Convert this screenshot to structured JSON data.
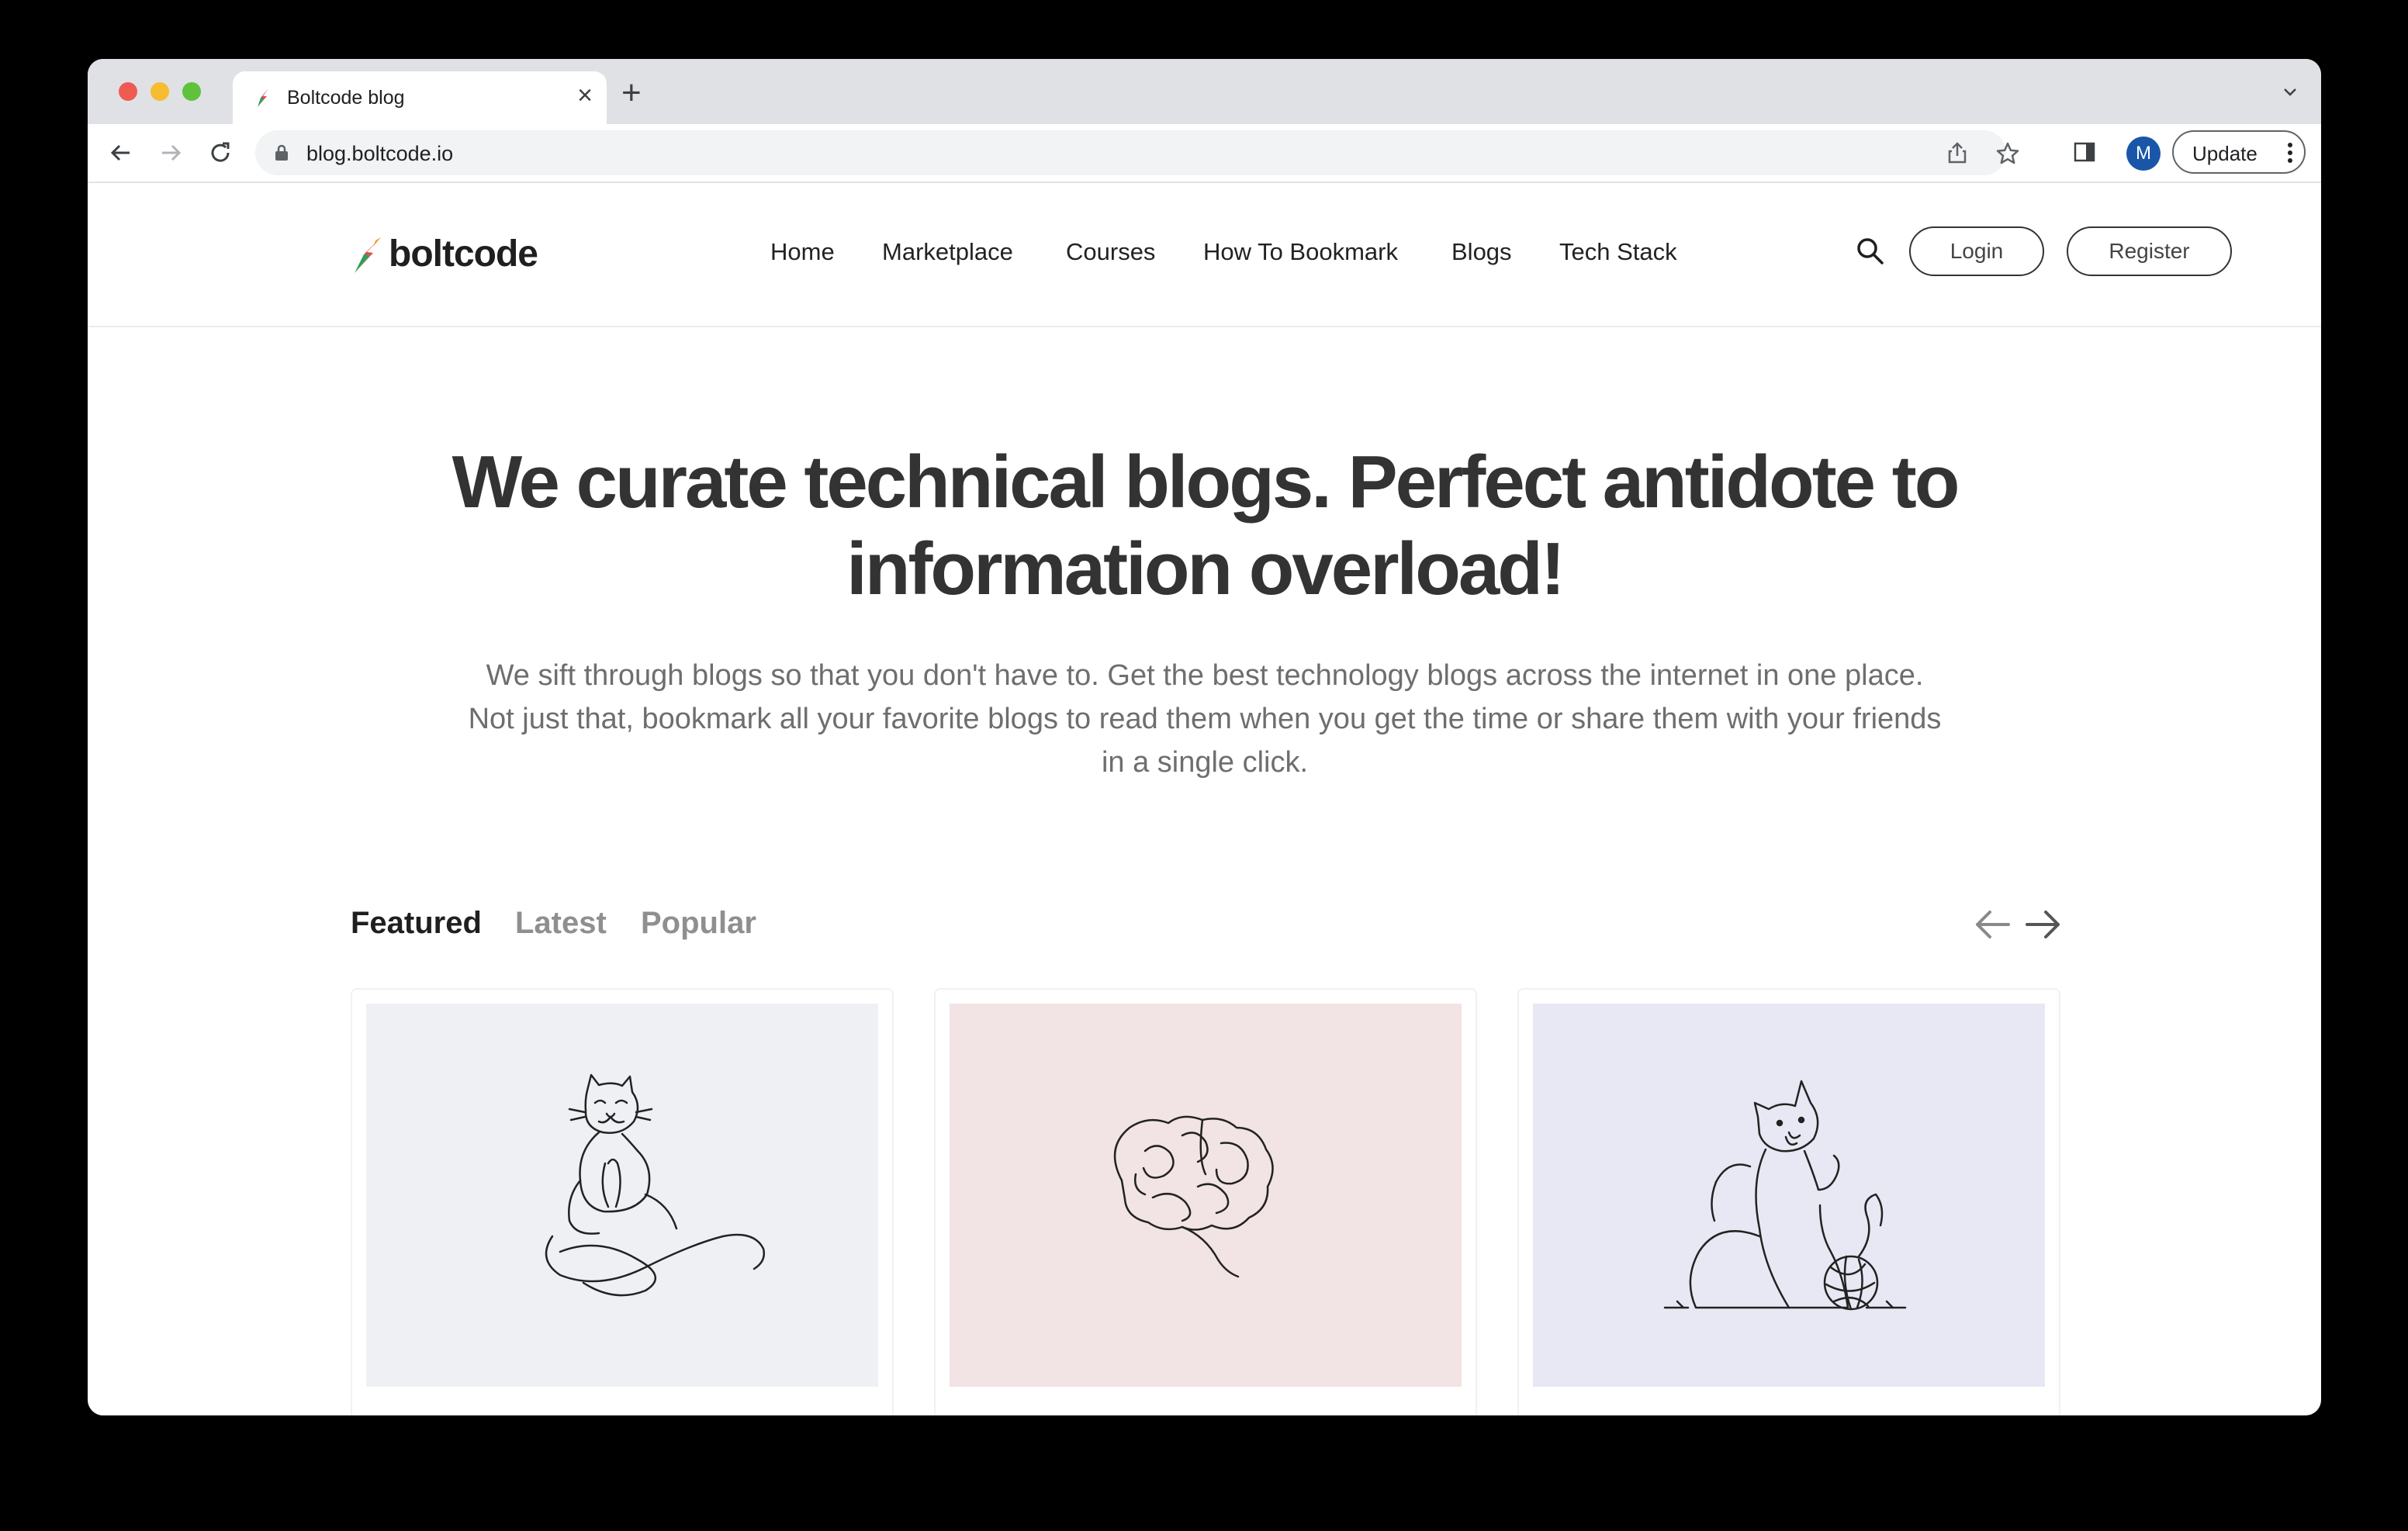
{
  "browser": {
    "tab_title": "Boltcode blog",
    "url": "blog.boltcode.io",
    "profile_initial": "M",
    "update_label": "Update"
  },
  "site": {
    "logo_text": "boltcode",
    "nav": [
      "Home",
      "Marketplace",
      "Courses",
      "How To Bookmark",
      "Blogs",
      "Tech Stack"
    ],
    "login_label": "Login",
    "register_label": "Register"
  },
  "hero": {
    "title_line1": "We curate technical blogs. Perfect antidote to",
    "title_line2": "information overload!",
    "subtitle_line1": "We sift through blogs so that you don't have to. Get the best technology blogs across the internet in one place.",
    "subtitle_line2": "Not just that, bookmark all your favorite blogs to read them when you get the time or share them with your friends",
    "subtitle_line3": "in a single click."
  },
  "feed": {
    "tabs": [
      "Featured",
      "Latest",
      "Popular"
    ],
    "active_tab": "Featured"
  },
  "cards": [
    {
      "illustration": "meditating-cat-illustration",
      "bg_color": "#eff0f4"
    },
    {
      "illustration": "brain-illustration",
      "bg_color": "#f2e3e4"
    },
    {
      "illustration": "cat-with-yarn-illustration",
      "bg_color": "#e7e8f3"
    }
  ],
  "colors": {
    "text_dark": "#333333",
    "text_muted": "#6e6e6e",
    "logo_green": "#2e9e5b",
    "logo_red": "#e2474b"
  }
}
